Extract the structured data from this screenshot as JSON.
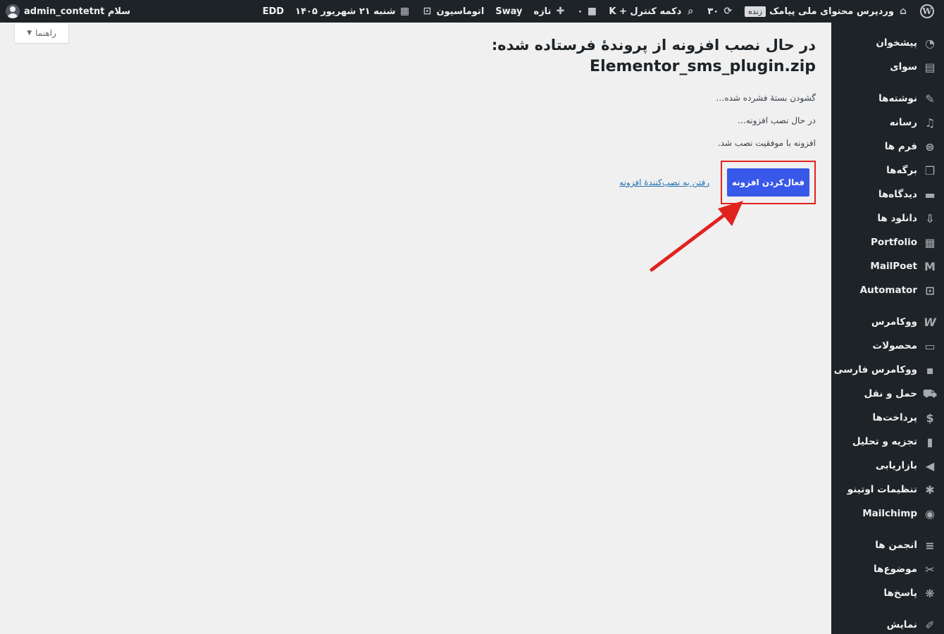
{
  "adminbar": {
    "site_name": "وردپرس محتوای ملی پیامک",
    "live_badge": "زنده",
    "updates_count": "۳۰",
    "control_key": "دکمه کنترل + K",
    "comments_count": "۰",
    "new_label": "تازه",
    "sway_label": "Sway",
    "automation_label": "اتوماسیون",
    "date_label": "شنبه ۲۱ شهریور ۱۴۰۵",
    "edd_label": "EDD",
    "greeting": "سلام admin_contetnt"
  },
  "help_tab": {
    "label": "راهنما"
  },
  "main": {
    "title": "در حال نصب افزونه از پروندهٔ فرستاده شده:",
    "filename": "Elementor_sms_plugin.zip",
    "messages": [
      "گشودن بستهٔ فشرده شده…",
      "در حال نصب افزونه…",
      "افزونه با موفقیت نصب شد."
    ],
    "activate_button": "فعال‌کردن افزونه",
    "installer_link": "رفتن به نصب‌کنندهٔ افزونه"
  },
  "sidebar": {
    "items": [
      {
        "label": "پیشخوان",
        "icon": "dashboard-icon"
      },
      {
        "label": "سوای",
        "icon": "sway-icon"
      },
      {
        "label": "نوشته‌ها",
        "icon": "pin-icon"
      },
      {
        "label": "رسانه",
        "icon": "media-icon"
      },
      {
        "label": "فرم ها",
        "icon": "forms-icon"
      },
      {
        "label": "برگه‌ها",
        "icon": "pages-icon"
      },
      {
        "label": "دیدگاه‌ها",
        "icon": "comments-icon"
      },
      {
        "label": "دانلود ها",
        "icon": "download-icon"
      },
      {
        "label": "Portfolio",
        "icon": "portfolio-icon"
      },
      {
        "label": "MailPoet",
        "icon": "mailpoet-icon"
      },
      {
        "label": "Automator",
        "icon": "automator-icon"
      },
      {
        "label": "ووکامرس",
        "icon": "woocommerce-icon"
      },
      {
        "label": "محصولات",
        "icon": "products-icon"
      },
      {
        "label": "ووکامرس فارسی",
        "icon": "woo-persian-icon"
      },
      {
        "label": "حمل و نقل",
        "icon": "shipping-icon"
      },
      {
        "label": "پرداخت‌ها",
        "icon": "payments-icon"
      },
      {
        "label": "تجزیه و تحلیل",
        "icon": "analytics-icon"
      },
      {
        "label": "بازاریابی",
        "icon": "marketing-icon"
      },
      {
        "label": "تنظیمات اوتینو",
        "icon": "asterisk-icon"
      },
      {
        "label": "Mailchimp",
        "icon": "mailchimp-icon"
      },
      {
        "label": "انجمن ها",
        "icon": "forums-icon"
      },
      {
        "label": "موضوع‌ها",
        "icon": "topics-icon"
      },
      {
        "label": "پاسخ‌ها",
        "icon": "replies-icon"
      },
      {
        "label": "نمایش",
        "icon": "appearance-icon"
      }
    ]
  },
  "colors": {
    "adminbar_bg": "#1d2327",
    "primary_button": "#3858e9",
    "highlight_box": "#e0231f",
    "arrow": "#e0231f",
    "link": "#2271b1"
  }
}
